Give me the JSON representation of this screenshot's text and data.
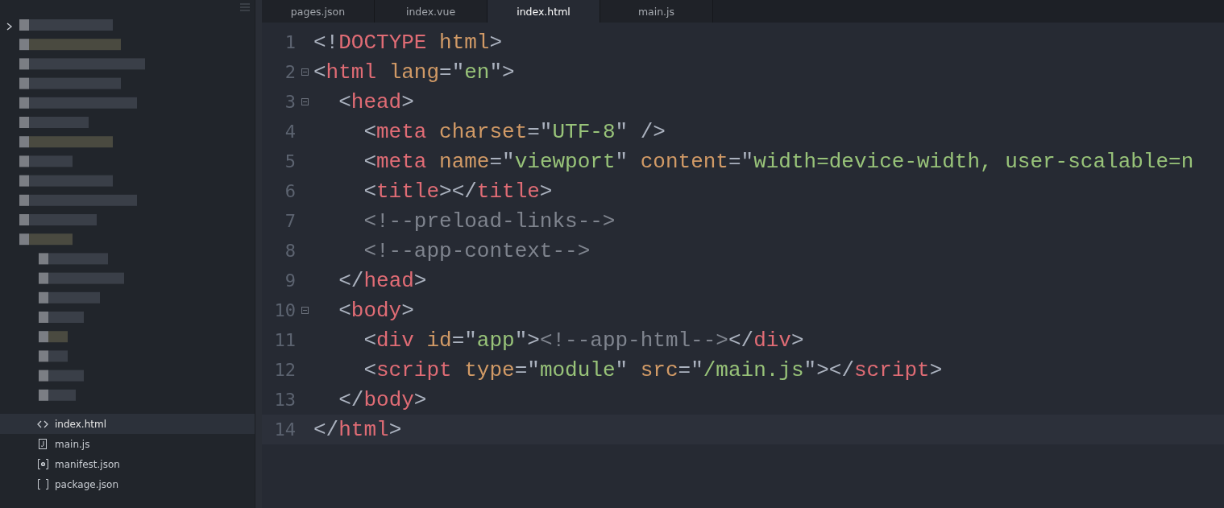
{
  "tabs": [
    {
      "label": "pages.json",
      "selected": false
    },
    {
      "label": "index.vue",
      "selected": false
    },
    {
      "label": "index.html",
      "selected": true
    },
    {
      "label": "main.js",
      "selected": false
    }
  ],
  "sidebar": {
    "files": [
      {
        "name": "index.html",
        "kind": "code",
        "selected": true
      },
      {
        "name": "main.js",
        "kind": "js",
        "selected": false
      },
      {
        "name": "manifest.json",
        "kind": "settings",
        "selected": false
      },
      {
        "name": "package.json",
        "kind": "brackets",
        "selected": false
      }
    ]
  },
  "editor": {
    "lines": [
      {
        "number": "1",
        "fold": false,
        "current": false,
        "tokens": [
          {
            "kind": "punct",
            "text": "<!"
          },
          {
            "kind": "tag",
            "text": "DOCTYPE"
          },
          {
            "kind": "attr",
            "text": " html"
          },
          {
            "kind": "punct",
            "text": ">"
          }
        ]
      },
      {
        "number": "2",
        "fold": true,
        "current": false,
        "tokens": [
          {
            "kind": "punct",
            "text": "<"
          },
          {
            "kind": "tag",
            "text": "html"
          },
          {
            "kind": "attr",
            "text": " lang"
          },
          {
            "kind": "punct",
            "text": "=\""
          },
          {
            "kind": "str",
            "text": "en"
          },
          {
            "kind": "punct",
            "text": "\">"
          }
        ]
      },
      {
        "number": "3",
        "fold": true,
        "current": false,
        "tokens": [
          {
            "kind": "punct",
            "text": "  <"
          },
          {
            "kind": "tag",
            "text": "head"
          },
          {
            "kind": "punct",
            "text": ">"
          }
        ]
      },
      {
        "number": "4",
        "fold": false,
        "current": false,
        "tokens": [
          {
            "kind": "punct",
            "text": "    <"
          },
          {
            "kind": "tag",
            "text": "meta"
          },
          {
            "kind": "attr",
            "text": " charset"
          },
          {
            "kind": "punct",
            "text": "=\""
          },
          {
            "kind": "str",
            "text": "UTF-8"
          },
          {
            "kind": "punct",
            "text": "\" />"
          }
        ]
      },
      {
        "number": "5",
        "fold": false,
        "current": false,
        "tokens": [
          {
            "kind": "punct",
            "text": "    <"
          },
          {
            "kind": "tag",
            "text": "meta"
          },
          {
            "kind": "attr",
            "text": " name"
          },
          {
            "kind": "punct",
            "text": "=\""
          },
          {
            "kind": "str",
            "text": "viewport"
          },
          {
            "kind": "punct",
            "text": "\" "
          },
          {
            "kind": "attr",
            "text": "content"
          },
          {
            "kind": "punct",
            "text": "=\""
          },
          {
            "kind": "str",
            "text": "width=device-width, user-scalable=n"
          }
        ]
      },
      {
        "number": "6",
        "fold": false,
        "current": false,
        "tokens": [
          {
            "kind": "punct",
            "text": "    <"
          },
          {
            "kind": "tag",
            "text": "title"
          },
          {
            "kind": "punct",
            "text": "></"
          },
          {
            "kind": "tag",
            "text": "title"
          },
          {
            "kind": "punct",
            "text": ">"
          }
        ]
      },
      {
        "number": "7",
        "fold": false,
        "current": false,
        "tokens": [
          {
            "kind": "comment",
            "text": "    <!--preload-links-->"
          }
        ]
      },
      {
        "number": "8",
        "fold": false,
        "current": false,
        "tokens": [
          {
            "kind": "comment",
            "text": "    <!--app-context-->"
          }
        ]
      },
      {
        "number": "9",
        "fold": false,
        "current": false,
        "tokens": [
          {
            "kind": "punct",
            "text": "  </"
          },
          {
            "kind": "tag",
            "text": "head"
          },
          {
            "kind": "punct",
            "text": ">"
          }
        ]
      },
      {
        "number": "10",
        "fold": true,
        "current": false,
        "tokens": [
          {
            "kind": "punct",
            "text": "  <"
          },
          {
            "kind": "tag",
            "text": "body"
          },
          {
            "kind": "punct",
            "text": ">"
          }
        ]
      },
      {
        "number": "11",
        "fold": false,
        "current": false,
        "tokens": [
          {
            "kind": "punct",
            "text": "    <"
          },
          {
            "kind": "tag",
            "text": "div"
          },
          {
            "kind": "attr",
            "text": " id"
          },
          {
            "kind": "punct",
            "text": "=\""
          },
          {
            "kind": "str",
            "text": "app"
          },
          {
            "kind": "punct",
            "text": "\">"
          },
          {
            "kind": "comment",
            "text": "<!--app-html-->"
          },
          {
            "kind": "punct",
            "text": "</"
          },
          {
            "kind": "tag",
            "text": "div"
          },
          {
            "kind": "punct",
            "text": ">"
          }
        ]
      },
      {
        "number": "12",
        "fold": false,
        "current": false,
        "tokens": [
          {
            "kind": "punct",
            "text": "    <"
          },
          {
            "kind": "tag",
            "text": "script"
          },
          {
            "kind": "attr",
            "text": " type"
          },
          {
            "kind": "punct",
            "text": "=\""
          },
          {
            "kind": "str",
            "text": "module"
          },
          {
            "kind": "punct",
            "text": "\" "
          },
          {
            "kind": "attr",
            "text": "src"
          },
          {
            "kind": "punct",
            "text": "=\""
          },
          {
            "kind": "str",
            "text": "/main.js"
          },
          {
            "kind": "punct",
            "text": "\"></"
          },
          {
            "kind": "tag",
            "text": "script"
          },
          {
            "kind": "punct",
            "text": ">"
          }
        ]
      },
      {
        "number": "13",
        "fold": false,
        "current": false,
        "tokens": [
          {
            "kind": "punct",
            "text": "  </"
          },
          {
            "kind": "tag",
            "text": "body"
          },
          {
            "kind": "punct",
            "text": ">"
          }
        ]
      },
      {
        "number": "14",
        "fold": false,
        "current": true,
        "tokens": [
          {
            "kind": "punct",
            "text": "</"
          },
          {
            "kind": "tag",
            "text": "html"
          },
          {
            "kind": "punct",
            "text": ">"
          }
        ]
      }
    ]
  }
}
